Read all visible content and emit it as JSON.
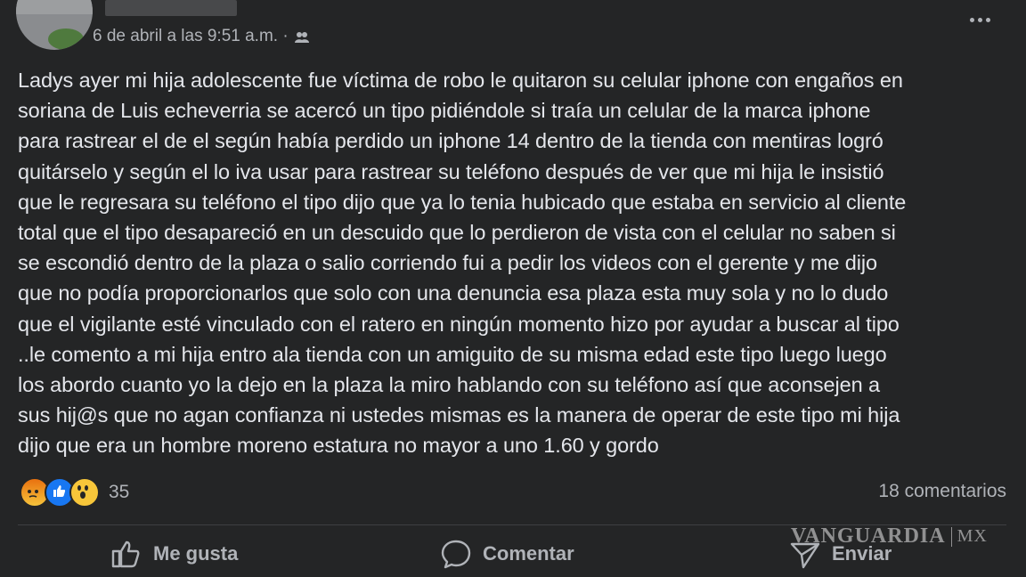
{
  "post": {
    "time": "6 de abril a las 9:51 a.m. ·",
    "privacy_icon": "friends-icon",
    "text": "Ladys ayer mi hija  adolescente  fue víctima de robo le quitaron su celular iphone con engaños en\nsoriana de Luis echeverria  se acercó un tipo pidiéndole si traía un celular  de la marca iphone\npara rastrear el de el según había perdido un iphone 14 dentro de la tienda  con mentiras logró\nquitárselo y según el lo iva usar para rastrear su teléfono   después de ver que mi hija le insistió\nque le regresara su teléfono el tipo dijo que ya lo tenia hubicado que estaba en servicio al cliente\ntotal que el tipo desapareció en un descuido que lo perdieron de vista con el celular no saben si\nse escondió dentro de la plaza o salio corriendo fui a pedir los  videos con el gerente  y me dijo\nque no podía proporcionarlos  que solo con una denuncia  esa plaza esta muy sola y no lo dudo\nque el vigilante esté vinculado con el ratero en ningún momento hizo por ayudar a buscar al tipo\n..le comento a mi hija  entro ala tienda con un amiguito de su misma edad  este  tipo luego luego\nlos abordo  cuanto yo la dejo en la plaza la miro hablando con su teléfono  así que aconsejen a\nsus hij@s que no agan confianza ni ustedes mismas es la manera de operar de este tipo mi hija\ndijo que era un hombre moreno estatura no mayor a uno 1.60 y gordo"
  },
  "reactions": {
    "icons": [
      "angry-reaction-icon",
      "like-reaction-icon",
      "wow-reaction-icon"
    ],
    "count": "35",
    "comments": "18 comentarios"
  },
  "actions": {
    "like": "Me gusta",
    "comment": "Comentar",
    "send": "Enviar"
  },
  "watermark": {
    "brand": "VANGUARDIA",
    "country": "MX"
  },
  "colors": {
    "background": "#242526",
    "text": "#e4e6eb",
    "secondary": "#b0b3b8"
  }
}
